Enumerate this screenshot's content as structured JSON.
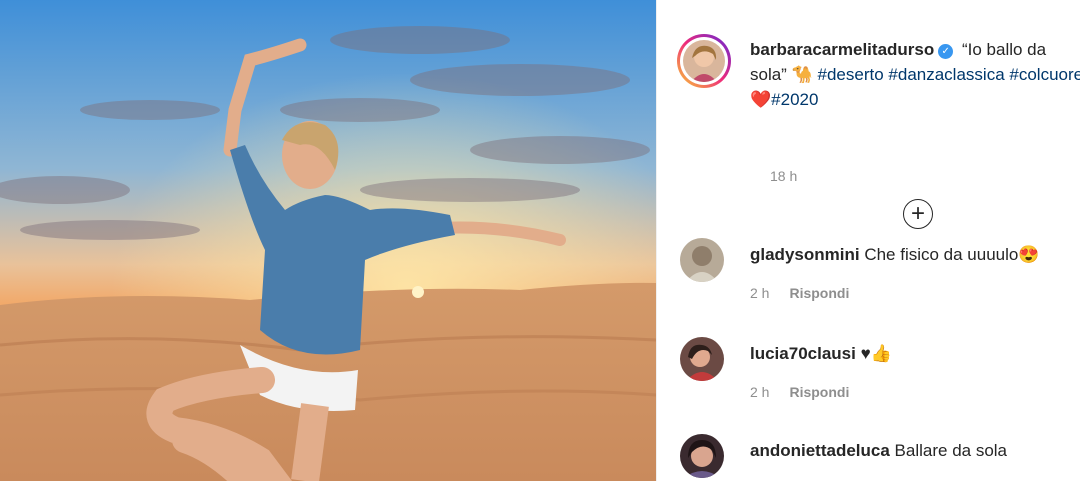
{
  "post": {
    "username": "barbaracarmelitadurso",
    "verified_icon": "verified-badge-icon",
    "caption_quote": "“Io ballo da sola”",
    "caption_emoji": "🐪",
    "hashtags": [
      "#deserto",
      "#danzaclassica",
      "#colcuore"
    ],
    "heart_emoji": "❤️",
    "last_hashtag": "#2020",
    "time": "18 h",
    "load_more_icon": "plus-circle-icon"
  },
  "comments": [
    {
      "username": "gladysonmini",
      "text": "Che fisico da uuuulo",
      "emoji": "😍",
      "time": "2 h",
      "reply": "Rispondi"
    },
    {
      "username": "lucia70clausi",
      "text": "♥",
      "emoji": "👍",
      "time": "2 h",
      "reply": "Rispondi"
    },
    {
      "username": "andonietta­deluca",
      "text": "Ballare da sola",
      "emoji": "",
      "time": "",
      "reply": ""
    }
  ],
  "colors": {
    "link": "#00376b",
    "verified": "#3897f0",
    "muted": "#8e8e8e"
  }
}
